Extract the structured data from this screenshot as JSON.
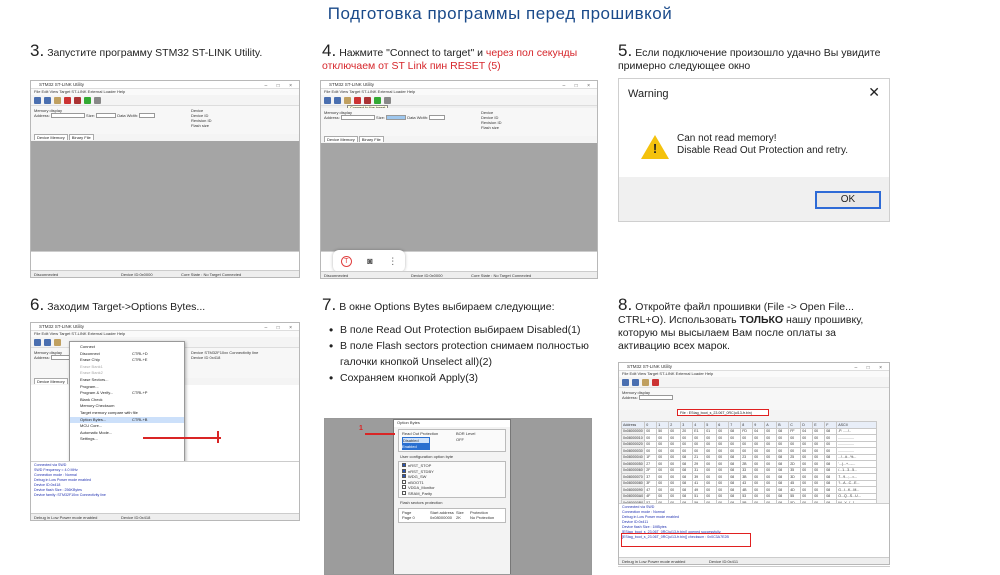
{
  "page": {
    "title": "Подготовка программы перед прошивкой"
  },
  "steps": [
    {
      "num": "3.",
      "text": "Запустите программу STM32 ST-LINK Utility."
    },
    {
      "num": "4.",
      "text": "Нажмите \"Connect to target\" и ",
      "red": "через пол секунды отключаем от ST Link пин RESET (5)"
    },
    {
      "num": "5.",
      "text": "Если подключение произошло удачно Вы увидите примерно следующее окно"
    },
    {
      "num": "6.",
      "text": "Заходим Target->Options Bytes..."
    },
    {
      "num": "7.",
      "text": "В окне Options Bytes выбираем следующие:",
      "bullets": [
        "В поле Read Out Protection выбираем Disabled(1)",
        "В поле Flash sectors protection снимаем полностью галочки кнопкой Unselect all)(2)",
        "Сохраняем кнопкой Apply(3)"
      ]
    },
    {
      "num": "8.",
      "text": "Откройте файл прошивки (File -> Open File... CTRL+O). Использовать ",
      "bold": "ТОЛЬКО",
      "text2": " нашу прошивку, которую мы высылаем Вам после оплаты за активацию всех марок."
    }
  ],
  "stlink": {
    "title": "STM32 ST-LINK Utility",
    "menu": "File   Edit   View   Target   ST-LINK   External Loader   Help",
    "memory_display": "Memory display",
    "address_label": "Address:",
    "address_value": "0x08000000",
    "size_label": "Size:",
    "data_width_label": "Data Width:",
    "data_width_value": "8 bits",
    "device_info": [
      "Device",
      "Device ID",
      "Revision ID",
      "Flash size"
    ],
    "tabs": [
      "Device Memory",
      "Binary File"
    ],
    "device_memory": "Device Memory",
    "status_left": "Disconnected",
    "status_mid": "Device ID:0x0000",
    "status_right": "Core State : No Target Connected",
    "connect_tooltip": "Connect to the target"
  },
  "warning": {
    "title": "Warning",
    "line1": "Can not read memory!",
    "line2": "Disable Read Out Protection and retry.",
    "ok": "OK"
  },
  "target_menu": {
    "items": [
      "Connect",
      "Disconnect",
      "Erase Chip",
      "Erase Bank1",
      "Erase Bank2",
      "Erase Sectors...",
      "Program...",
      "Program & Verify...",
      "Blank Check",
      "Memory Checksum",
      "Target memory compare with file",
      "Option Bytes...",
      "MCU Core...",
      "Automatic Mode...",
      "Settings..."
    ],
    "shortcuts": [
      "",
      "CTRL+D",
      "CTRL+E",
      "",
      "",
      "",
      "",
      "CTRL+P",
      "",
      "",
      "",
      "CTRL+B",
      "",
      "",
      ""
    ],
    "device": "STM32F10xx Connectivity line",
    "device_id": "0x418",
    "log_lines": [
      "Connected via SWD",
      "SWD Frequency = 4.0 MHz",
      "Connection mode : Normal",
      "Debug in Low Power mode enabled",
      "Device ID:0x418",
      "Device flash Size : 256KBytes",
      "Device family :STM32F10xx Connectivity line"
    ],
    "status": "Debug in Low Power mode enabled",
    "status_mid": "Device ID:0x418"
  },
  "options": {
    "title": "Option Bytes",
    "rop_label": "Read Out Protection",
    "rop_value": "Enabled",
    "rop_selected": "Disabled",
    "bor_label": "BOR Level",
    "bor_value": "OFF",
    "user_config": "User configuration option byte",
    "rows": [
      "nRST_STOP",
      "nRST_STDBY",
      "WDG_SW",
      "nBOOT1",
      "VDDA_Monitor",
      "SRAM_Parity"
    ],
    "sector_label": "Flash sectors protection",
    "page_col": "Page",
    "start_col": "Start address",
    "size_col": "Size",
    "prot_col": "Protection",
    "sector_rows": [
      [
        "Page 0",
        "0x08000000",
        "2K",
        "No Protection"
      ]
    ],
    "marker": "1"
  },
  "file_view": {
    "title": "STM32 ST-LINK Utility",
    "file_tab": "File : EStag_boot_s_23.06T_0RC(ul13-fr.bin)",
    "header_cells": [
      "Address",
      "0",
      "1",
      "2",
      "3",
      "4",
      "5",
      "6",
      "7",
      "8",
      "9",
      "A",
      "B",
      "C",
      "D",
      "E",
      "F",
      "ASCII"
    ],
    "rows": [
      [
        "0x08000000",
        "00",
        "50",
        "00",
        "20",
        "E1",
        "01",
        "00",
        "08",
        "FD",
        "04",
        "00",
        "08",
        "FF",
        "04",
        "00",
        "08",
        ".P. .....!.."
      ],
      [
        "0x08000010",
        "00",
        "00",
        "00",
        "00",
        "00",
        "00",
        "00",
        "00",
        "00",
        "00",
        "00",
        "00",
        "00",
        "00",
        "00",
        "00",
        "................"
      ],
      [
        "0x08000020",
        "00",
        "00",
        "00",
        "00",
        "00",
        "00",
        "00",
        "00",
        "00",
        "00",
        "00",
        "00",
        "00",
        "00",
        "00",
        "00",
        "................"
      ],
      [
        "0x08000030",
        "00",
        "00",
        "00",
        "00",
        "00",
        "00",
        "00",
        "00",
        "00",
        "00",
        "00",
        "00",
        "00",
        "00",
        "00",
        "00",
        "................"
      ],
      [
        "0x08000040",
        "1F",
        "00",
        "00",
        "08",
        "21",
        "00",
        "00",
        "08",
        "23",
        "00",
        "00",
        "08",
        "25",
        "00",
        "00",
        "08",
        "...!...#...%..."
      ],
      [
        "0x08000050",
        "27",
        "00",
        "00",
        "08",
        "29",
        "00",
        "00",
        "08",
        "2B",
        "00",
        "00",
        "08",
        "2D",
        "00",
        "00",
        "08",
        "'...)...+...-..."
      ],
      [
        "0x08000060",
        "2F",
        "00",
        "00",
        "08",
        "31",
        "00",
        "00",
        "08",
        "33",
        "00",
        "00",
        "08",
        "35",
        "00",
        "00",
        "08",
        "/...1...3...5..."
      ],
      [
        "0x08000070",
        "37",
        "00",
        "00",
        "08",
        "39",
        "00",
        "00",
        "08",
        "3B",
        "00",
        "00",
        "08",
        "3D",
        "00",
        "00",
        "08",
        "7...9...;...=..."
      ],
      [
        "0x08000080",
        "3F",
        "00",
        "00",
        "08",
        "41",
        "00",
        "00",
        "08",
        "43",
        "00",
        "00",
        "08",
        "45",
        "00",
        "00",
        "08",
        "?...A...C...E..."
      ],
      [
        "0x08000090",
        "47",
        "00",
        "00",
        "08",
        "49",
        "00",
        "00",
        "08",
        "4B",
        "00",
        "00",
        "08",
        "4D",
        "00",
        "00",
        "08",
        "G...I...K...M..."
      ],
      [
        "0x080000A0",
        "4F",
        "00",
        "00",
        "08",
        "51",
        "00",
        "00",
        "08",
        "53",
        "00",
        "00",
        "08",
        "55",
        "00",
        "00",
        "08",
        "O...Q...S...U..."
      ],
      [
        "0x080000B0",
        "57",
        "00",
        "00",
        "08",
        "59",
        "00",
        "00",
        "08",
        "5B",
        "00",
        "00",
        "08",
        "5D",
        "00",
        "00",
        "08",
        "W...Y...[...]..."
      ]
    ],
    "log_lines": [
      "Connected via SWD",
      "Connection mode : Normal",
      "Debug in Low Power mode enabled",
      "Device ID:0x411",
      "Device flash Size : 1MBytes",
      "[EStag_boot_s_23.06T_0RC(ul13-fr.bin)] opened successfully.",
      "[EStag_boot_s_23.06T_0RC(ul13-fr.bin)] checksum : 0x0C3A7E2B"
    ],
    "status": "Debug in Low Power mode enabled",
    "status_mid": "Device ID:0x411"
  }
}
